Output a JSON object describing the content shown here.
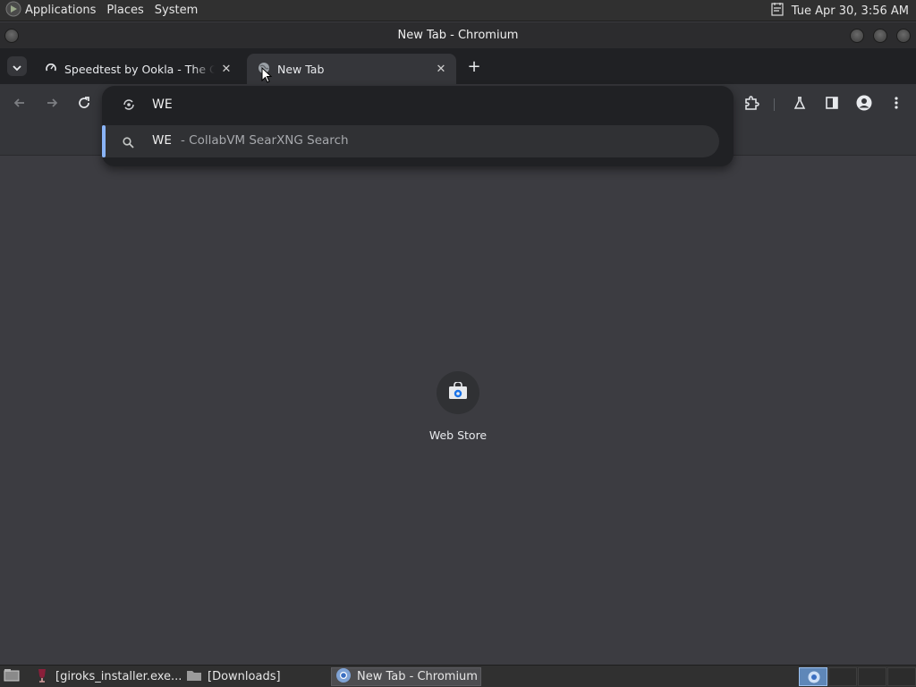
{
  "top_panel": {
    "menus": [
      "Applications",
      "Places",
      "System"
    ],
    "clock": "Tue Apr 30,  3:56 AM",
    "icons": [
      "gnome-foot-icon",
      "notes-clipboard-icon"
    ]
  },
  "window": {
    "title": "New Tab - Chromium"
  },
  "tabs": [
    {
      "title": "Speedtest by Ookla - The Global Broadband Speed Test",
      "icon": "speedtest-gauge-icon",
      "active": false
    },
    {
      "title": "New Tab",
      "icon": "globe-icon",
      "active": true
    }
  ],
  "omnibox": {
    "value": "WE",
    "suggestion": {
      "query": "WE",
      "description": "- CollabVM SearXNG Search",
      "icon": "search-icon"
    }
  },
  "content": {
    "shortcut": {
      "label": "Web Store",
      "icon": "web-store-icon"
    }
  },
  "taskbar": {
    "tasks": [
      {
        "label": "[giroks_installer.exe...",
        "icon": "wine-icon"
      },
      {
        "label": "[Downloads]",
        "icon": "folder-icon"
      },
      {
        "label": "New Tab - Chromium",
        "icon": "chromium-icon"
      }
    ]
  },
  "colors": {
    "accent": "#8ab4f8",
    "tab_strip": "#202124",
    "toolbar": "#35363a",
    "content_bg": "#3c3c41"
  }
}
